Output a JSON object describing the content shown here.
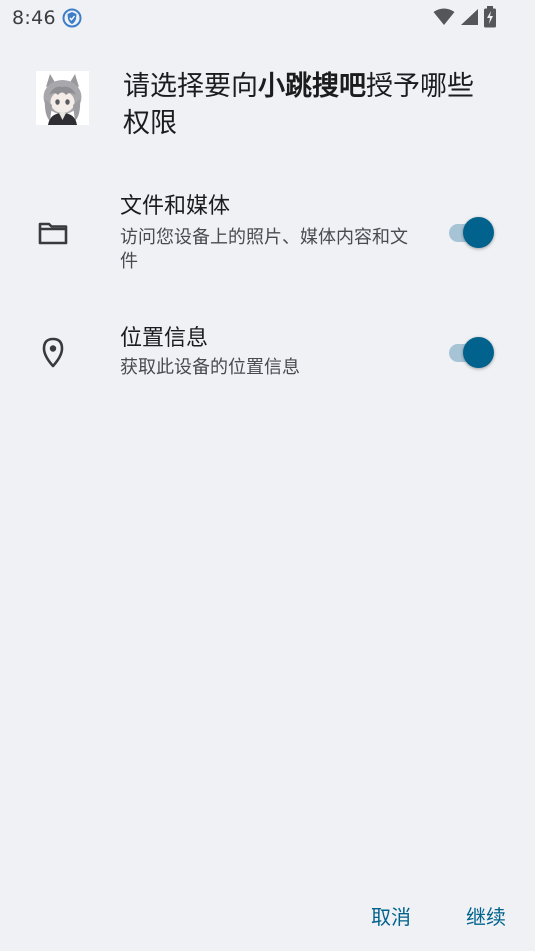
{
  "status_bar": {
    "time": "8:46",
    "icons": [
      "shield-notification-icon",
      "wifi-icon",
      "cellular-signal-icon",
      "battery-charging-icon"
    ]
  },
  "dialog": {
    "title_prefix": "请选择要向",
    "app_name": "小跳搜吧",
    "title_suffix": "授予哪些权限",
    "app_icon": "anime-character-avatar"
  },
  "permissions": [
    {
      "icon": "folder-icon",
      "title": "文件和媒体",
      "description": "访问您设备上的照片、媒体内容和文件",
      "enabled": true
    },
    {
      "icon": "location-pin-icon",
      "title": "位置信息",
      "description": "获取此设备的位置信息",
      "enabled": true
    }
  ],
  "actions": {
    "cancel_label": "取消",
    "continue_label": "继续"
  },
  "colors": {
    "background": "#eff1f4",
    "accent": "#00628d",
    "toggle_track": "#a7c4d6"
  }
}
